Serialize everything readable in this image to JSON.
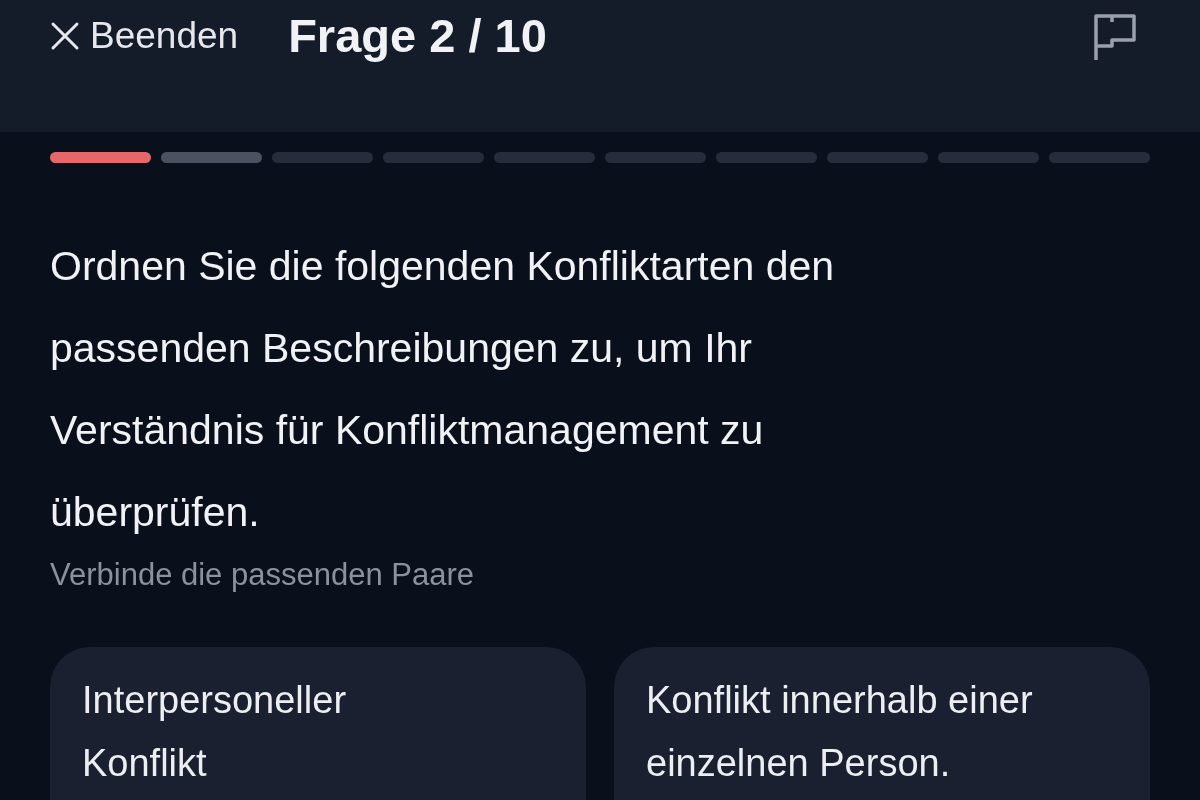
{
  "header": {
    "close_label": "Beenden",
    "title": "Frage 2 / 10"
  },
  "progress": [
    {
      "completed": true,
      "current": false
    },
    {
      "completed": false,
      "current": true
    },
    {
      "completed": false,
      "current": false
    },
    {
      "completed": false,
      "current": false
    },
    {
      "completed": false,
      "current": false
    },
    {
      "completed": false,
      "current": false
    },
    {
      "completed": false,
      "current": false
    },
    {
      "completed": false,
      "current": false
    },
    {
      "completed": false,
      "current": false
    },
    {
      "completed": false,
      "current": false
    }
  ],
  "question": "Ordnen Sie die folgenden Konfliktarten den passenden Beschreibungen zu, um Ihr Verständnis für Konfliktmanagement zu überprüfen.",
  "hint": "Verbinde die passenden Paare",
  "pairs": [
    {
      "left": "Interpersoneller Konflikt",
      "right": "Konflikt innerhalb einer einzelnen Person."
    }
  ]
}
